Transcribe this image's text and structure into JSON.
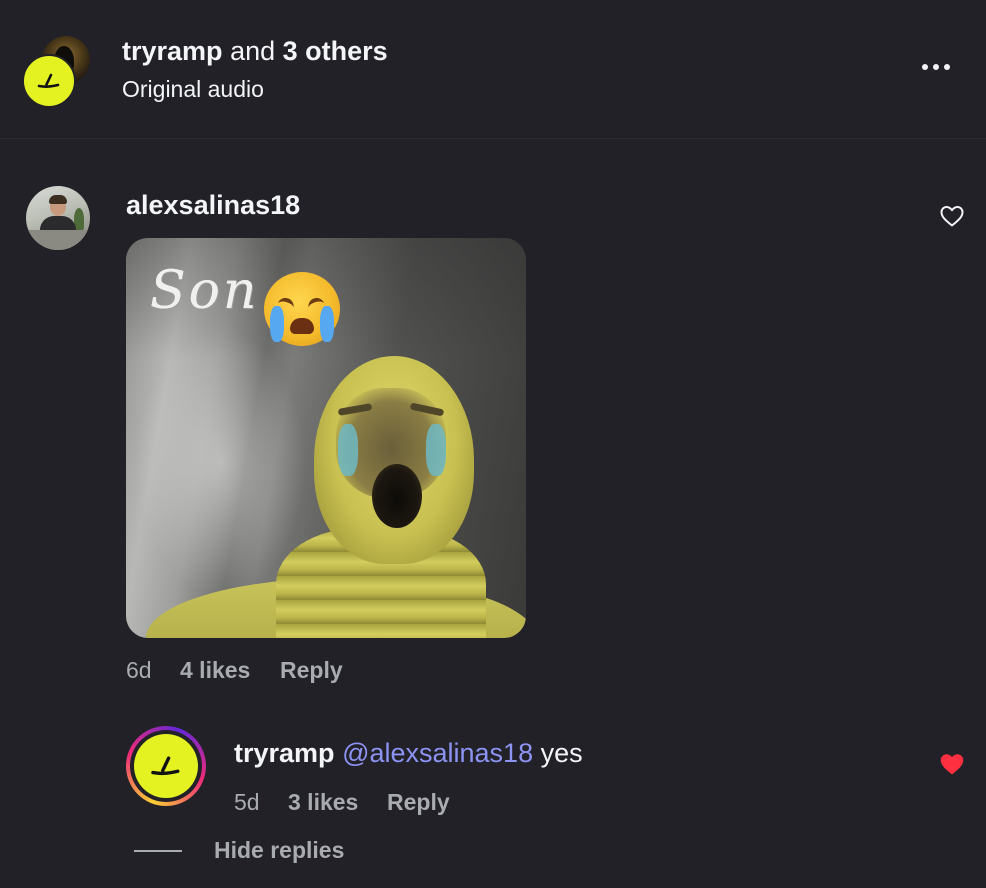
{
  "header": {
    "primary_user": "tryramp",
    "joiner": "and",
    "others": "3 others",
    "subtitle": "Original audio",
    "more_icon": "more-horizontal-icon"
  },
  "comment": {
    "username": "alexsalinas18",
    "gif_caption": "Son",
    "gif_emoji": "😭",
    "time": "6d",
    "likes": "4 likes",
    "reply_label": "Reply",
    "like_icon": "heart-outline-icon",
    "liked": false
  },
  "reply": {
    "username": "tryramp",
    "mention": "@alexsalinas18",
    "text": "yes",
    "time": "5d",
    "likes": "3 likes",
    "reply_label": "Reply",
    "like_icon": "heart-filled-icon",
    "liked": true
  },
  "thread": {
    "hide_replies_label": "Hide replies"
  },
  "colors": {
    "background": "#212127",
    "primary_text": "#f3f5f7",
    "secondary_text": "#a8abb0",
    "mention": "#8d93f2",
    "like_red": "#ff3040",
    "ramp_yellow": "#e4f222"
  }
}
